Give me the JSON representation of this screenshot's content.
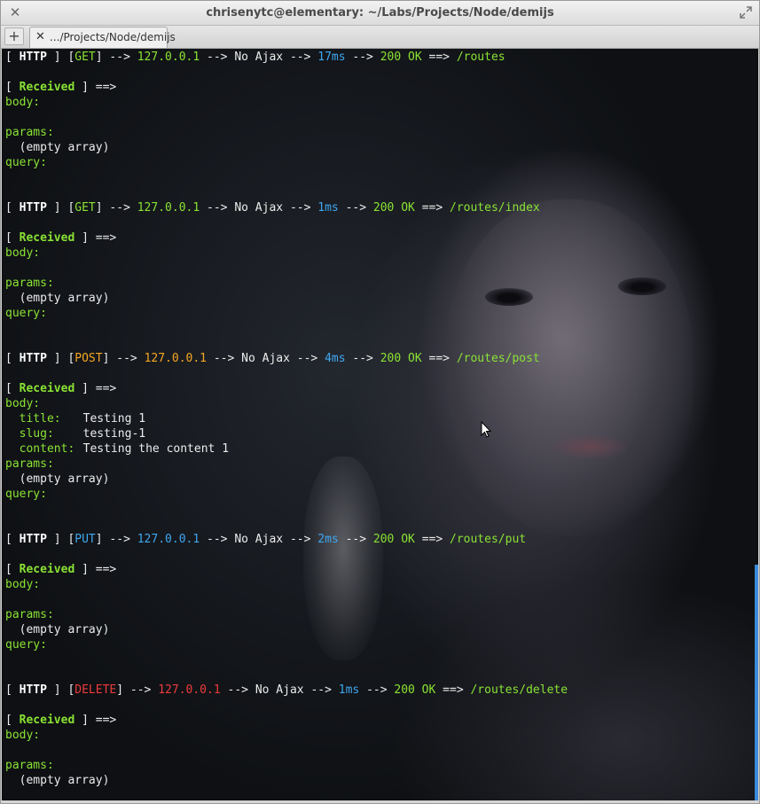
{
  "window": {
    "title": "chrisenytc@elementary: ~/Labs/Projects/Node/demijs",
    "close_glyph": "✕",
    "tab_label": ".../Projects/Node/demijs",
    "new_tab_glyph": "+"
  },
  "log": {
    "block1": {
      "tag": "HTTP",
      "method": "GET",
      "ip": "127.0.0.1",
      "ajax": "No Ajax",
      "time": "17ms",
      "status": "200 OK",
      "route": "/routes"
    },
    "block2": {
      "tag": "HTTP",
      "method": "GET",
      "ip": "127.0.0.1",
      "ajax": "No Ajax",
      "time": "1ms",
      "status": "200 OK",
      "route": "/routes/index"
    },
    "block3": {
      "tag": "HTTP",
      "method": "POST",
      "ip": "127.0.0.1",
      "ajax": "No Ajax",
      "time": "4ms",
      "status": "200 OK",
      "route": "/routes/post",
      "fields": [
        {
          "key": "title:",
          "value": "Testing 1"
        },
        {
          "key": "slug:",
          "value": "testing-1"
        },
        {
          "key": "content:",
          "value": "Testing the content 1"
        }
      ]
    },
    "block4": {
      "tag": "HTTP",
      "method": "PUT",
      "ip": "127.0.0.1",
      "ajax": "No Ajax",
      "time": "2ms",
      "status": "200 OK",
      "route": "/routes/put"
    },
    "block5": {
      "tag": "HTTP",
      "method": "DELETE",
      "ip": "127.0.0.1",
      "ajax": "No Ajax",
      "time": "1ms",
      "status": "200 OK",
      "route": "/routes/delete"
    },
    "received": "Received",
    "body": "body:",
    "params": "params:",
    "query": "query:",
    "empty": "(empty array)",
    "arrow": "-->",
    "darrow": "==>"
  },
  "colors": {
    "green": "#8ae234",
    "blue": "#3fa7f0",
    "orange": "#f5a623",
    "red": "#ef3b3b",
    "scrollbar": "#3a8bd8"
  }
}
